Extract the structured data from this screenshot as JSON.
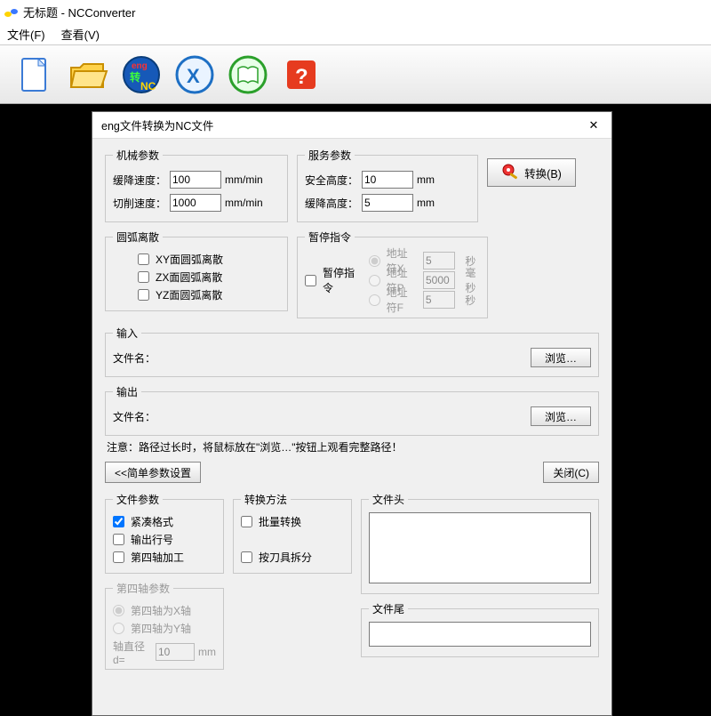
{
  "window": {
    "title": "无标题 - NCConverter"
  },
  "menu": {
    "file": "文件(F)",
    "view": "查看(V)"
  },
  "toolbar_icons": [
    "new-file",
    "open-folder",
    "eng-nc",
    "excel",
    "book",
    "help"
  ],
  "dialog": {
    "title": "eng文件转换为NC文件",
    "mech": {
      "legend": "机械参数",
      "slow_label": "缓降速度：",
      "slow_val": "100",
      "slow_unit": "mm/min",
      "cut_label": "切削速度：",
      "cut_val": "1000",
      "cut_unit": "mm/min"
    },
    "serv": {
      "legend": "服务参数",
      "safe_label": "安全高度：",
      "safe_val": "10",
      "safe_unit": "mm",
      "down_label": "缓降高度：",
      "down_val": "5",
      "down_unit": "mm"
    },
    "convert_btn": "转换(B)",
    "arc": {
      "legend": "圆弧离散",
      "xy": "XY面圆弧离散",
      "zx": "ZX面圆弧离散",
      "yz": "YZ面圆弧离散"
    },
    "pause": {
      "legend": "暂停指令",
      "enable": "暂停指令",
      "addrX": "地址符X",
      "valX": "5",
      "unitX": "秒",
      "addrP": "地址符P",
      "valP": "5000",
      "unitP": "毫秒",
      "addrF": "地址符F",
      "valF": "5",
      "unitF": "秒"
    },
    "input": {
      "legend": "输入",
      "fname": "文件名：",
      "browse": "浏览…"
    },
    "output": {
      "legend": "输出",
      "fname": "文件名：",
      "browse": "浏览…"
    },
    "notice": "注意：路径过长时，将鼠标放在\"浏览…\"按钮上观看完整路径！",
    "simple_btn": "<<简单参数设置",
    "close_btn": "关闭(C)",
    "fileparam": {
      "legend": "文件参数",
      "compact": "紧凑格式",
      "lineno": "输出行号",
      "axis4": "第四轴加工"
    },
    "method": {
      "legend": "转换方法",
      "batch": "批量转换",
      "bytool": "按刀具拆分"
    },
    "head": {
      "legend": "文件头"
    },
    "tail": {
      "legend": "文件尾"
    },
    "axis4p": {
      "legend": "第四轴参数",
      "asX": "第四轴为X轴",
      "asY": "第四轴为Y轴",
      "diam_label": "轴直径d=",
      "diam_val": "10",
      "diam_unit": "mm"
    }
  }
}
